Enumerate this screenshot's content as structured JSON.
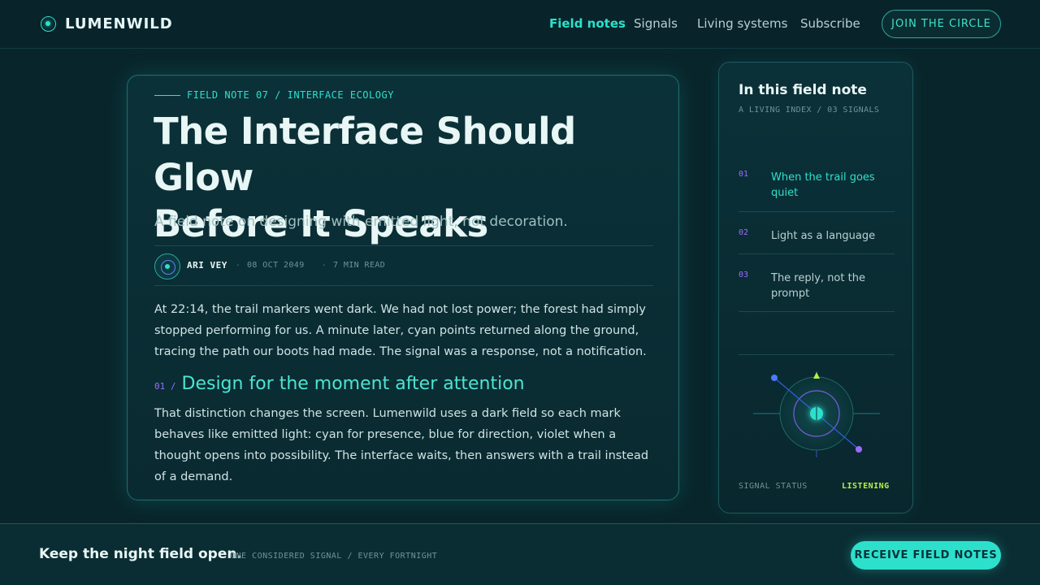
{
  "header": {
    "brand": "LUMENWILD",
    "nav": [
      {
        "label": "Field notes",
        "active": true
      },
      {
        "label": "Signals",
        "active": false
      },
      {
        "label": "Living systems",
        "active": false
      },
      {
        "label": "Subscribe",
        "active": false
      }
    ],
    "cta": "JOIN THE CIRCLE"
  },
  "article": {
    "kicker": "FIELD NOTE 07 / INTERFACE ECOLOGY",
    "title_line1": "The Interface Should Glow",
    "title_line2": "Before It Speaks",
    "dek": "A field note on designing with emitted light, not decoration.",
    "author": "ARI VEY",
    "date": "08 OCT 2049",
    "read_time": "7 MIN READ",
    "meta_sep": "·",
    "para1": "At 22:14, the trail markers went dark. We had not lost power; the forest had simply stopped performing for us. A minute later, cyan points returned along the ground, tracing the path our boots had made. The signal was a response, not a notification.",
    "section_num": "01 /",
    "section_title": "Design for the moment after attention",
    "para2": "That distinction changes the screen. Lumenwild uses a dark field so each mark behaves like emitted light: cyan for presence, blue for direction, violet when a thought opens into possibility. The interface waits, then answers with a trail instead of a demand."
  },
  "toc": {
    "title": "In this field note",
    "subtitle": "A LIVING INDEX / 03 SIGNALS",
    "items": [
      {
        "num": "01",
        "label": "When the trail goes quiet",
        "active": true
      },
      {
        "num": "02",
        "label": "Light as a language",
        "active": false
      },
      {
        "num": "03",
        "label": "The reply, not the prompt",
        "active": false
      }
    ],
    "status_label": "SIGNAL STATUS",
    "status_value": "LISTENING"
  },
  "footer": {
    "title": "Keep the night field open.",
    "subtitle": "ONE CONSIDERED SIGNAL / EVERY FORTNIGHT",
    "cta": "RECEIVE FIELD NOTES"
  },
  "colors": {
    "background": "#08252b",
    "accent_cyan": "#2de0cc",
    "accent_blue": "#4a7bff",
    "accent_violet": "#9b6cff",
    "status_green": "#b5f045"
  }
}
